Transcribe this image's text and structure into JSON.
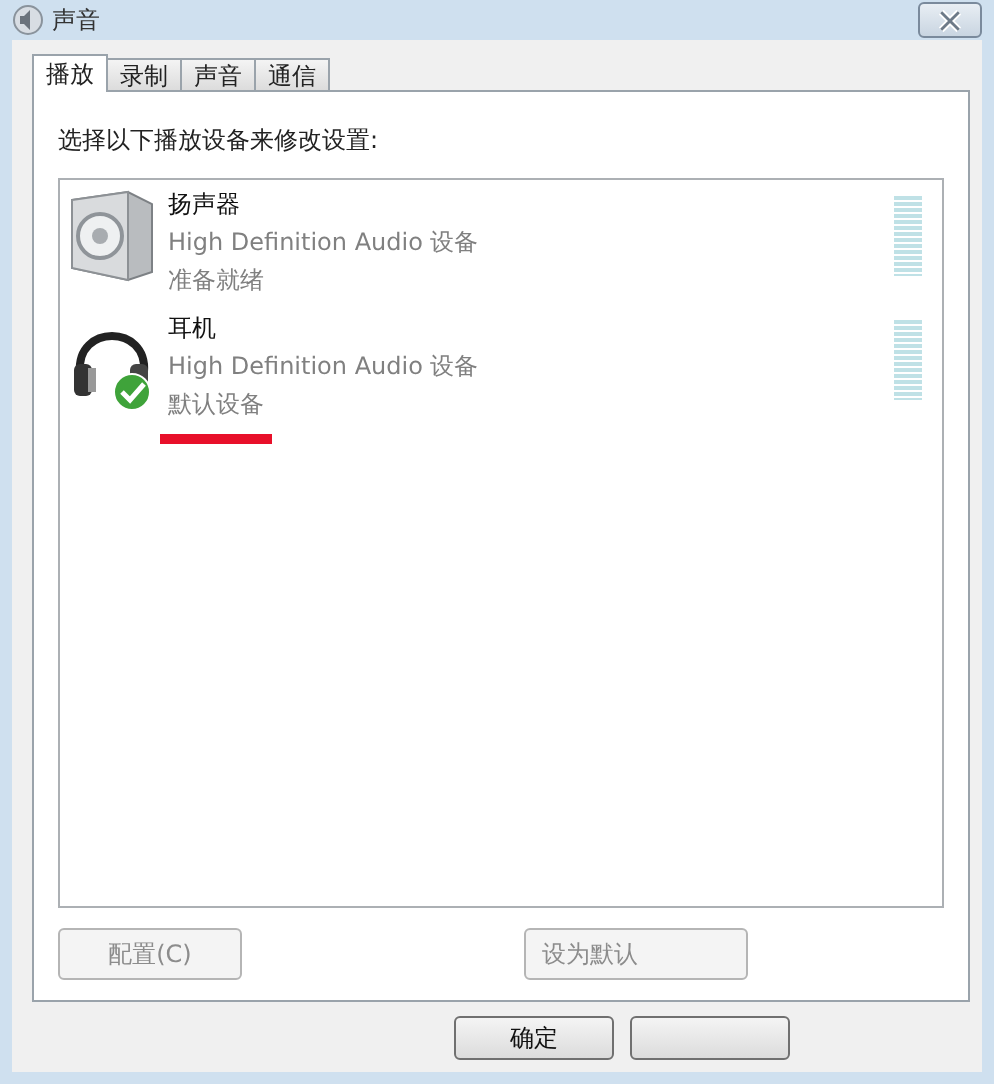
{
  "window": {
    "title": "声音"
  },
  "tabs": [
    {
      "label": "播放",
      "selected": true
    },
    {
      "label": "录制",
      "selected": false
    },
    {
      "label": "声音",
      "selected": false
    },
    {
      "label": "通信",
      "selected": false
    }
  ],
  "instruction": "选择以下播放设备来修改设置:",
  "devices": [
    {
      "kind": "speaker",
      "name": "扬声器",
      "driver": "High Definition Audio 设备",
      "status": "准备就绪",
      "default": false
    },
    {
      "kind": "headphones",
      "name": "耳机",
      "driver": "High Definition Audio 设备",
      "status": "默认设备",
      "default": true
    }
  ],
  "panel_buttons": [
    {
      "label": "配置(C)",
      "disabled": true
    },
    {
      "label": "设为默认",
      "disabled": true
    }
  ],
  "dialog_buttons": [
    {
      "label": "确定",
      "disabled": false
    }
  ]
}
